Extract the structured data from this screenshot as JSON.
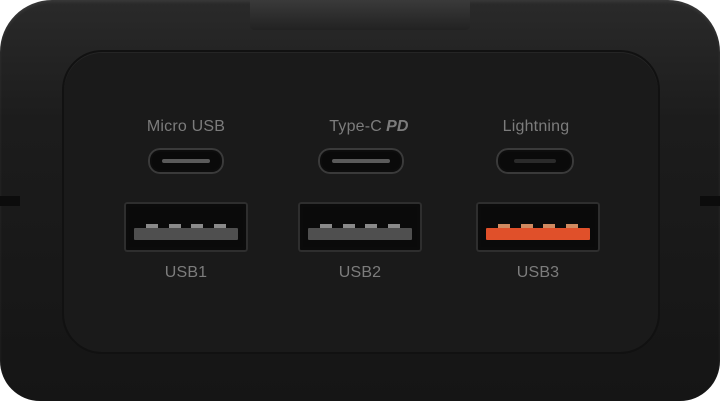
{
  "ports": {
    "micro_usb": {
      "label": "Micro USB"
    },
    "type_c": {
      "label": "Type-C",
      "badge": "PD"
    },
    "lightning": {
      "label": "Lightning"
    },
    "usb1": {
      "label": "USB1"
    },
    "usb2": {
      "label": "USB2"
    },
    "usb3": {
      "label": "USB3",
      "accent": "#e0502a"
    }
  },
  "colors": {
    "body": "#1c1c1c",
    "panel": "#1a1a1a",
    "label": "#7c7c7c"
  }
}
